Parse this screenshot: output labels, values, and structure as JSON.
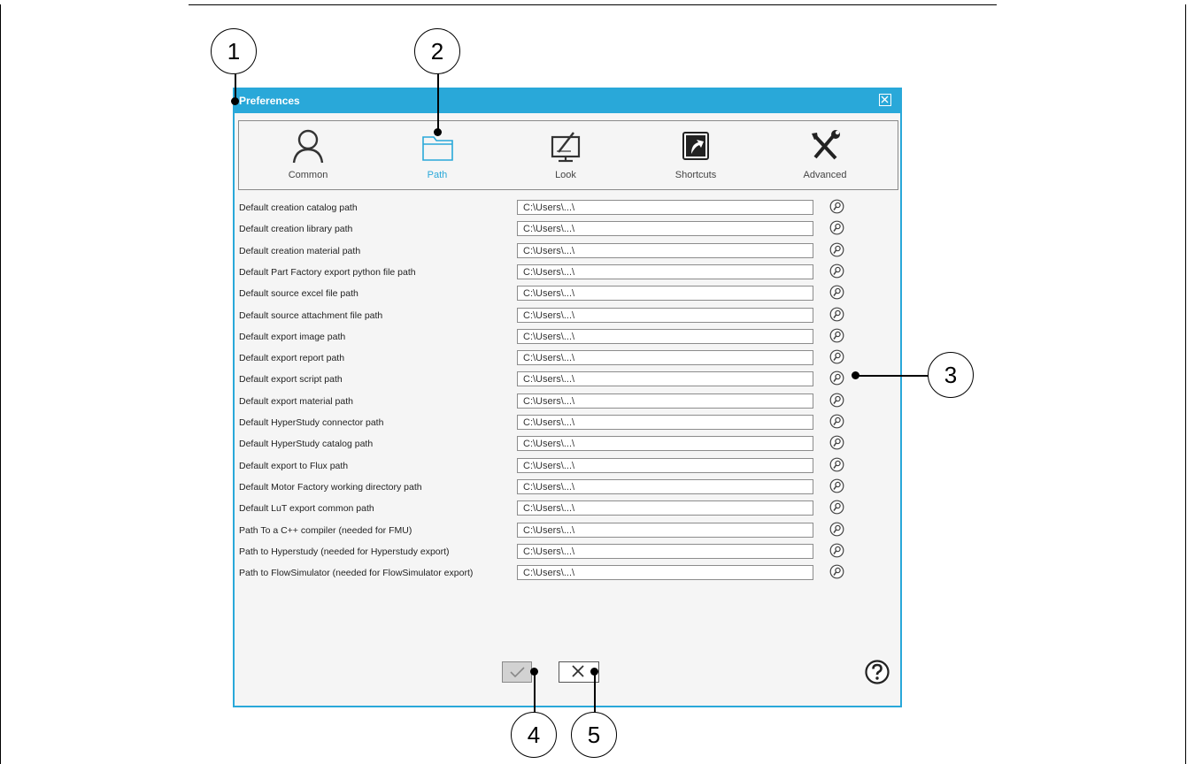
{
  "dialog": {
    "title": "Preferences",
    "close_icon": "close-icon"
  },
  "tabs": [
    {
      "label": "Common",
      "icon": "user-icon",
      "active": false
    },
    {
      "label": "Path",
      "icon": "folder-icon",
      "active": true
    },
    {
      "label": "Look",
      "icon": "monitor-pen-icon",
      "active": false
    },
    {
      "label": "Shortcuts",
      "icon": "shortcut-arrow-icon",
      "active": false
    },
    {
      "label": "Advanced",
      "icon": "tools-icon",
      "active": false
    }
  ],
  "paths": [
    {
      "label": "Default creation catalog path",
      "value": "C:\\Users\\...\\"
    },
    {
      "label": "Default creation library path",
      "value": "C:\\Users\\...\\"
    },
    {
      "label": "Default creation material path",
      "value": "C:\\Users\\...\\"
    },
    {
      "label": "Default Part Factory export python file path",
      "value": "C:\\Users\\...\\"
    },
    {
      "label": "Default source excel file path",
      "value": "C:\\Users\\...\\"
    },
    {
      "label": "Default source attachment file path",
      "value": "C:\\Users\\...\\"
    },
    {
      "label": "Default export image path",
      "value": "C:\\Users\\...\\"
    },
    {
      "label": "Default export report path",
      "value": "C:\\Users\\...\\"
    },
    {
      "label": "Default export script path",
      "value": "C:\\Users\\...\\"
    },
    {
      "label": "Default export material path",
      "value": "C:\\Users\\...\\"
    },
    {
      "label": "Default HyperStudy connector path",
      "value": "C:\\Users\\...\\"
    },
    {
      "label": "Default HyperStudy catalog path",
      "value": "C:\\Users\\...\\"
    },
    {
      "label": "Default export to Flux path",
      "value": "C:\\Users\\...\\"
    },
    {
      "label": "Default Motor Factory working directory path",
      "value": "C:\\Users\\...\\"
    },
    {
      "label": "Default LuT export common path",
      "value": "C:\\Users\\...\\"
    },
    {
      "label": "Path To a C++ compiler (needed for FMU)",
      "value": "C:\\Users\\...\\"
    },
    {
      "label": "Path to Hyperstudy (needed for Hyperstudy export)",
      "value": "C:\\Users\\...\\"
    },
    {
      "label": "Path to FlowSimulator (needed for FlowSimulator export)",
      "value": "C:\\Users\\...\\"
    }
  ],
  "browse_icon": "browse-magnifier-icon",
  "footer": {
    "ok_icon": "checkmark-icon",
    "cancel_icon": "x-icon",
    "help_icon": "help-icon"
  },
  "callouts": [
    "1",
    "2",
    "3",
    "4",
    "5"
  ],
  "colors": {
    "accent": "#29a8d9",
    "dialog_bg": "#f5f5f5"
  }
}
